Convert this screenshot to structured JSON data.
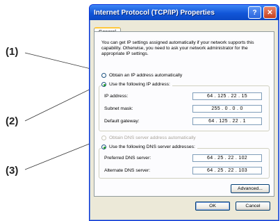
{
  "callouts": {
    "c1": "(1)",
    "c2": "(2)",
    "c3": "(3)"
  },
  "window": {
    "title": "Internet Protocol (TCP/IP) Properties",
    "help_glyph": "?",
    "close_glyph": "✕",
    "tab_label": "General",
    "description": "You can get IP settings assigned automatically if your network supports this capability. Otherwise, you need to ask your network administrator for the appropriate IP settings."
  },
  "ip_section": {
    "obtain_auto_label": "Obtain an IP address automatically",
    "use_following_label": "Use the following IP address:",
    "fields": [
      {
        "label": "IP address:",
        "value": "64 . 125 . 22 . 15"
      },
      {
        "label": "Subnet mask:",
        "value": "255 . 0 . 0 . 0"
      },
      {
        "label": "Default gateway:",
        "value": "64 . 125 . 22 . 1"
      }
    ]
  },
  "dns_section": {
    "obtain_auto_label": "Obtain DNS server address automatically",
    "use_following_label": "Use the following DNS server addresses:",
    "fields": [
      {
        "label": "Preferred DNS server:",
        "value": "64 . 25 . 22 . 102"
      },
      {
        "label": "Alternate DNS server:",
        "value": "64 . 25 . 22 . 103"
      }
    ]
  },
  "buttons": {
    "advanced": "Advanced...",
    "ok": "OK",
    "cancel": "Cancel"
  },
  "colors": {
    "titlebar": "#1156d8",
    "dialog_bg": "#ece9d8",
    "selected_radio": "#21a121"
  }
}
